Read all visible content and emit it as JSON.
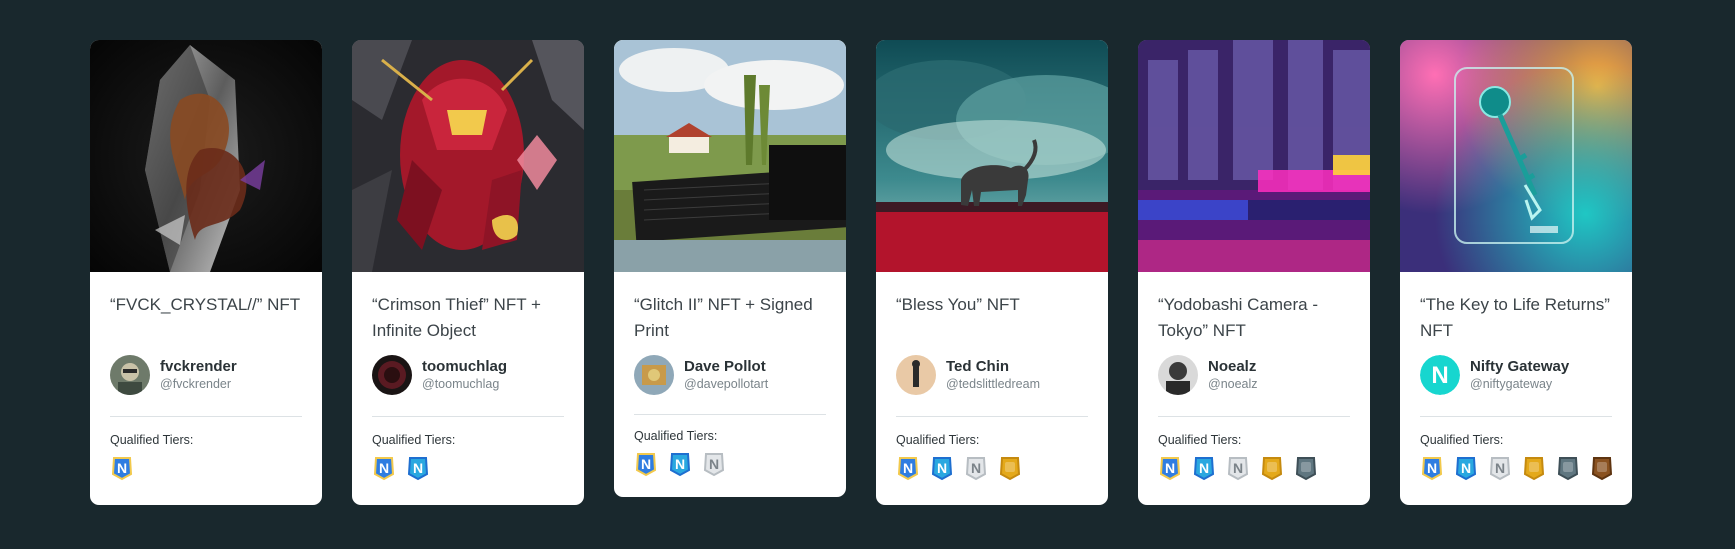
{
  "qualified_tiers_label": "Qualified Tiers:",
  "cards": [
    {
      "title": "“FVCK_CRYSTAL//” NFT",
      "creator_name": "fvckrender",
      "creator_handle": "@fvckrender",
      "tiers": [
        "n-blue"
      ]
    },
    {
      "title": "“Crimson Thief” NFT + Infinite Object",
      "creator_name": "toomuchlag",
      "creator_handle": "@toomuchlag",
      "tiers": [
        "n-blue",
        "n-cyan"
      ]
    },
    {
      "title": "“Glitch II” NFT + Signed Print",
      "creator_name": "Dave Pollot",
      "creator_handle": "@davepollotart",
      "tiers": [
        "n-blue",
        "n-cyan",
        "n-silver"
      ]
    },
    {
      "title": "“Bless You” NFT",
      "creator_name": "Ted Chin",
      "creator_handle": "@tedslittledream",
      "tiers": [
        "n-blue",
        "n-cyan",
        "n-silver",
        "gold"
      ]
    },
    {
      "title": "“Yodobashi Camera - Tokyo” NFT",
      "creator_name": "Noealz",
      "creator_handle": "@noealz",
      "tiers": [
        "n-blue",
        "n-cyan",
        "n-silver",
        "gold",
        "slate"
      ]
    },
    {
      "title": "“The Key to Life Returns” NFT",
      "creator_name": "Nifty Gateway",
      "creator_handle": "@niftygateway",
      "avatar_letter": "N",
      "tiers": [
        "n-blue",
        "n-cyan",
        "n-silver",
        "gold",
        "slate",
        "bronze"
      ]
    }
  ],
  "colors": {
    "page_background": "#19282d",
    "card_background": "#ffffff",
    "gold": "#e4a91a",
    "slate": "#5f7680",
    "bronze": "#8a5220",
    "teal_avatar": "#17d6cf"
  }
}
